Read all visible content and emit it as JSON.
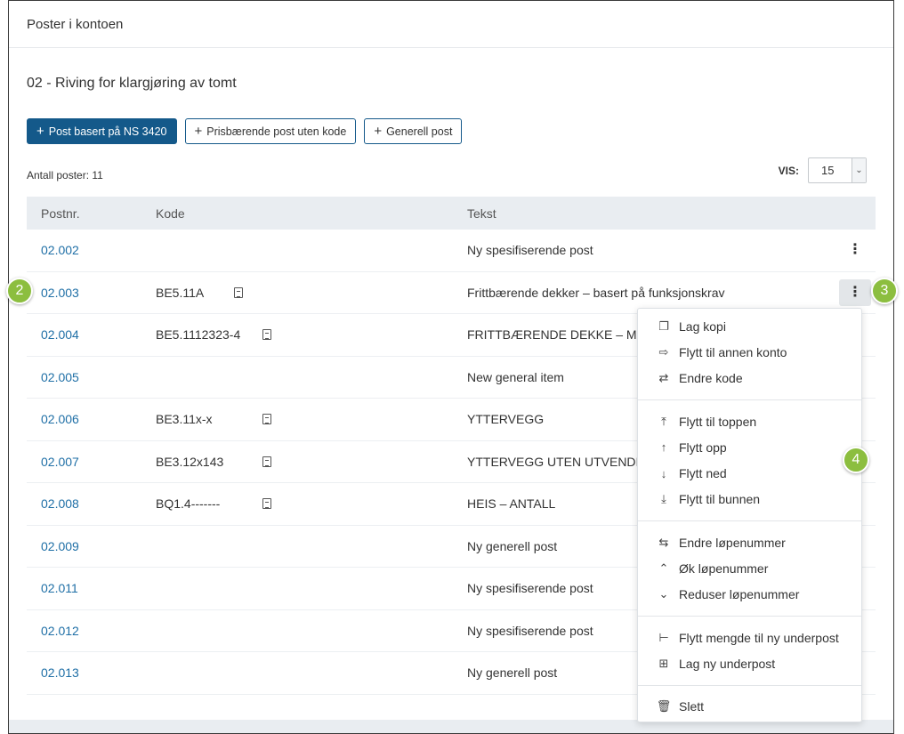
{
  "panel": {
    "title": "Poster i kontoen"
  },
  "section": {
    "title": "02 - Riving for klargjøring av tomt"
  },
  "buttons": {
    "ns3420": "Post basert på NS 3420",
    "prisbaerende": "Prisbærende post uten kode",
    "generell": "Generell post",
    "plus": "+"
  },
  "count_label": "Antall poster: 11",
  "vis": {
    "label": "VIS:",
    "value": "15"
  },
  "table": {
    "headers": {
      "postnr": "Postnr.",
      "kode": "Kode",
      "tekst": "Tekst"
    },
    "rows": [
      {
        "postnr": "02.002",
        "kode": "",
        "tekst": "Ny spesifiserende post"
      },
      {
        "postnr": "02.003",
        "kode": "BE5.11A",
        "tekst": "Frittbærende dekker – basert på funksjonskrav"
      },
      {
        "postnr": "02.004",
        "kode": "BE5.1112323-4",
        "tekst": "FRITTBÆRENDE DEKKE – ME"
      },
      {
        "postnr": "02.005",
        "kode": "",
        "tekst": "New general item"
      },
      {
        "postnr": "02.006",
        "kode": "BE3.11x-x",
        "tekst": "YTTERVEGG"
      },
      {
        "postnr": "02.007",
        "kode": "BE3.12x143",
        "tekst": "YTTERVEGG UTEN UTVENDI"
      },
      {
        "postnr": "02.008",
        "kode": "BQ1.4-------",
        "tekst": "HEIS – ANTALL"
      },
      {
        "postnr": "02.009",
        "kode": "",
        "tekst": "Ny generell post"
      },
      {
        "postnr": "02.011",
        "kode": "",
        "tekst": "Ny spesifiserende post"
      },
      {
        "postnr": "02.012",
        "kode": "",
        "tekst": "Ny spesifiserende post"
      },
      {
        "postnr": "02.013",
        "kode": "",
        "tekst": "Ny generell post"
      }
    ]
  },
  "menu": {
    "lag_kopi": "Lag kopi",
    "flytt_annen_konto": "Flytt til annen konto",
    "endre_kode": "Endre kode",
    "flytt_toppen": "Flytt til toppen",
    "flytt_opp": "Flytt opp",
    "flytt_ned": "Flytt ned",
    "flytt_bunnen": "Flytt til bunnen",
    "endre_lopenummer": "Endre løpenummer",
    "ok_lopenummer": "Øk løpenummer",
    "reduser_lopenummer": "Reduser løpenummer",
    "flytt_mengde": "Flytt mengde til ny underpost",
    "lag_underpost": "Lag ny underpost",
    "slett": "Slett"
  },
  "markers": {
    "m2": "2",
    "m3": "3",
    "m4": "4"
  },
  "colors": {
    "primary": "#14598a",
    "link": "#1f6fa6",
    "marker": "#8cbe3f",
    "header_bg": "#e9edf1"
  }
}
